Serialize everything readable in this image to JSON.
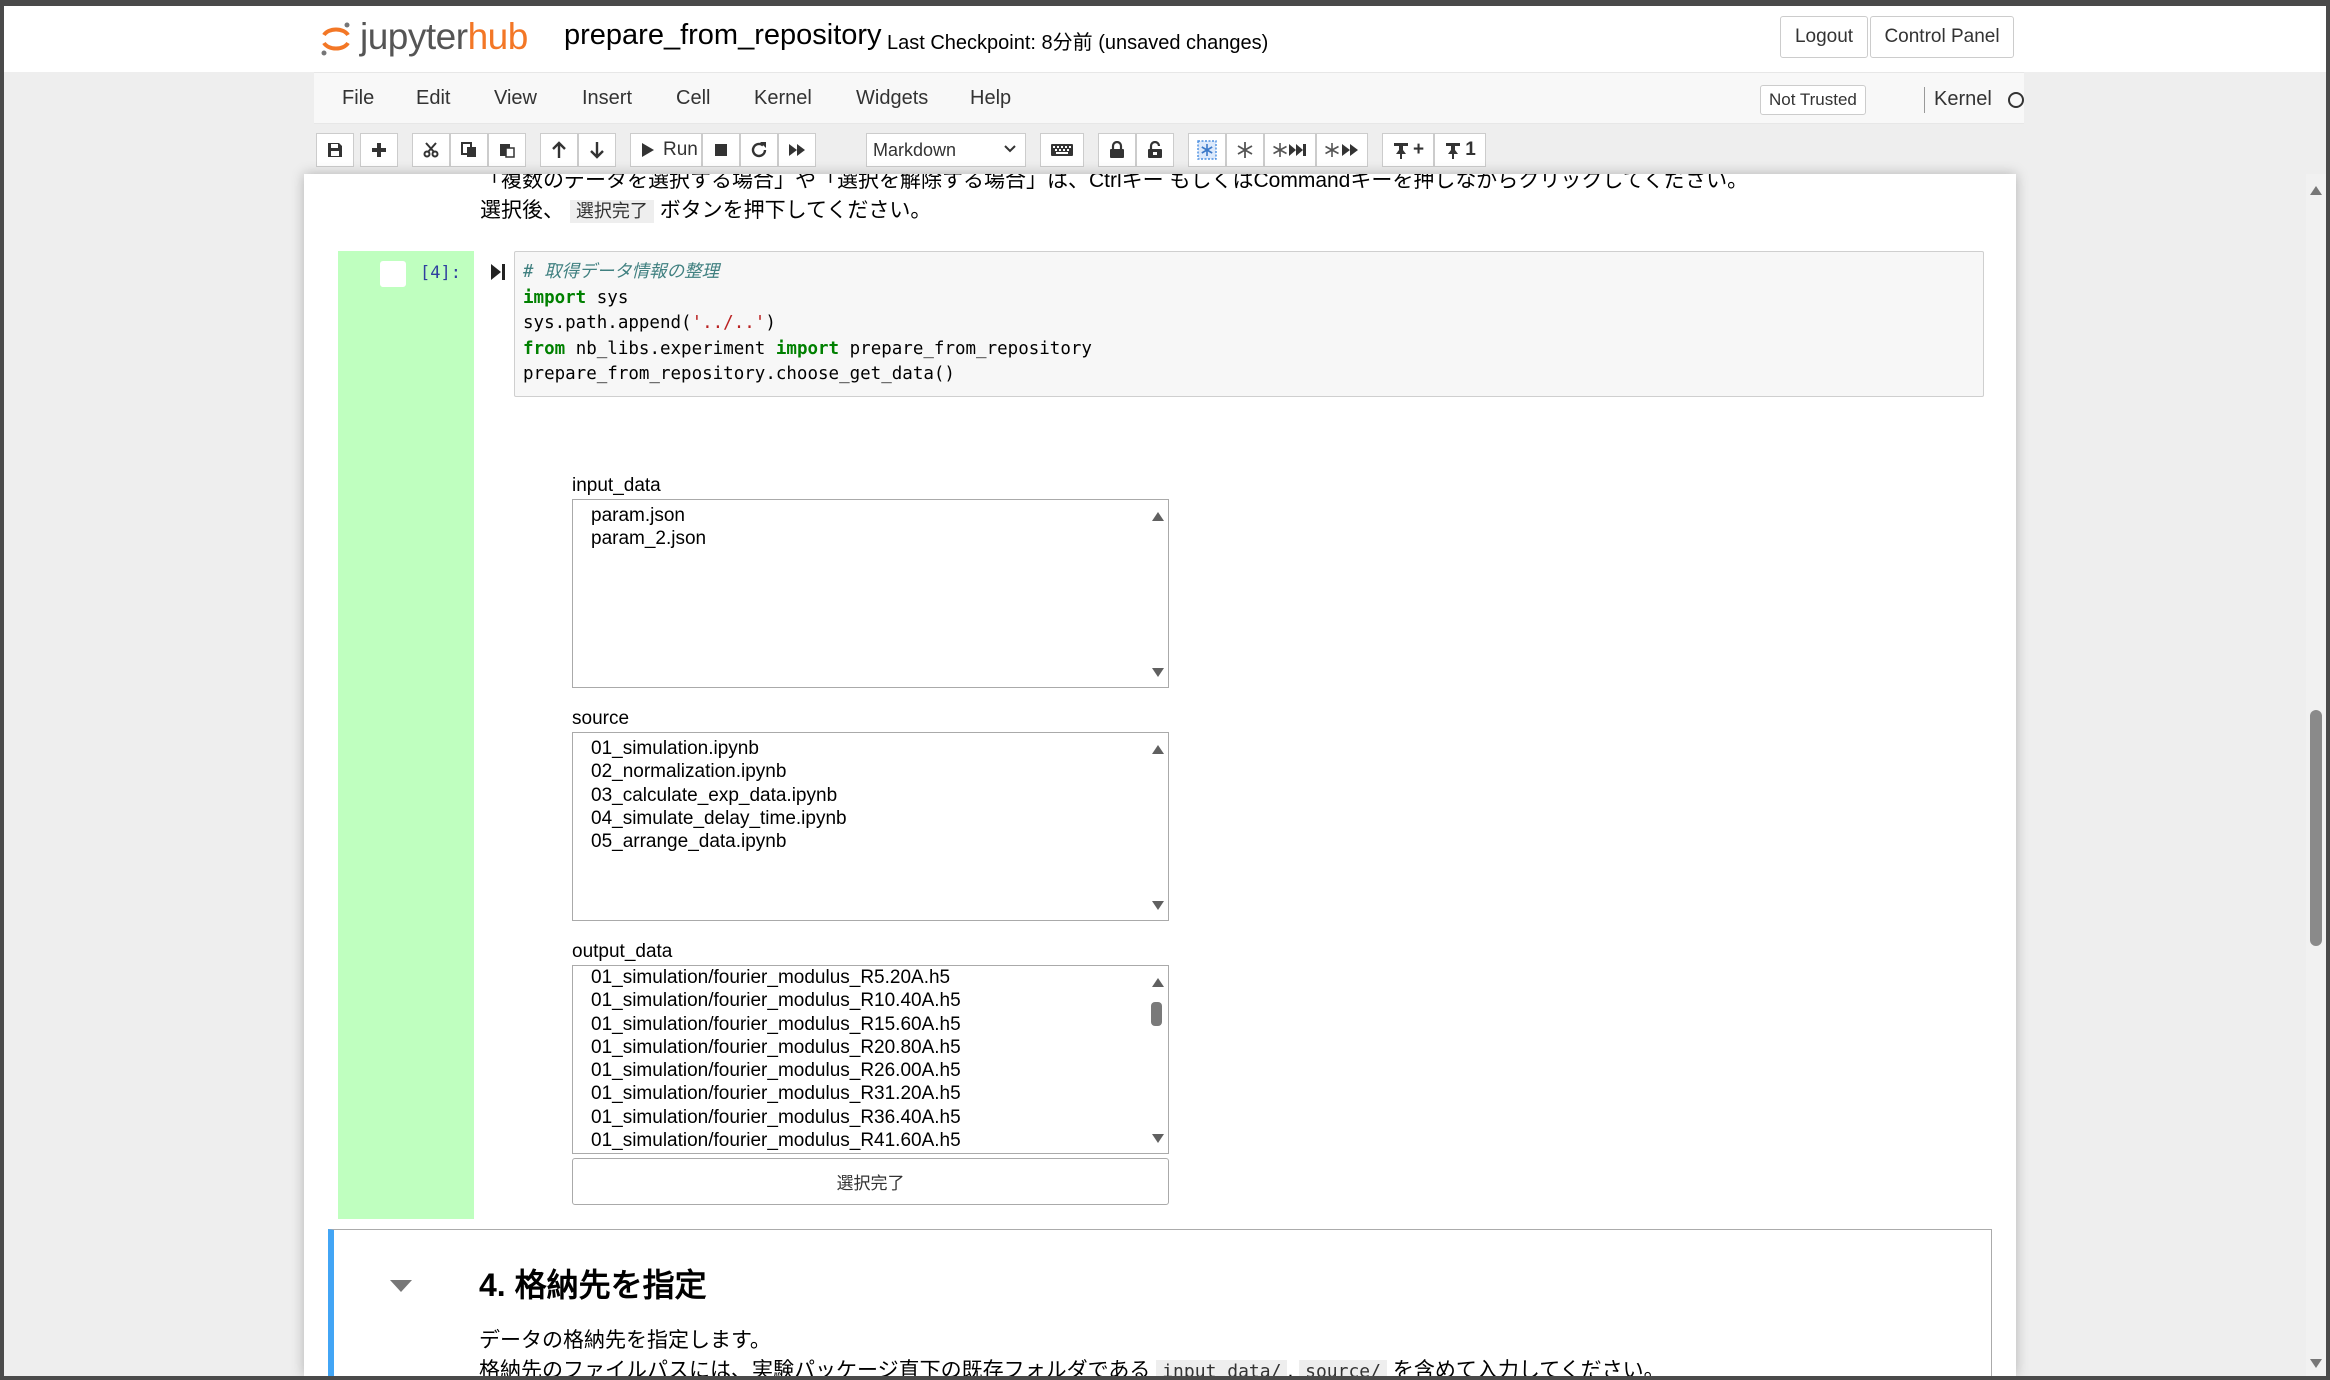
{
  "header": {
    "logo_jupyter": "jupyter",
    "logo_hub": "hub",
    "notebook_title": "prepare_from_repository",
    "checkpoint": "Last Checkpoint: 8分前   (unsaved changes)",
    "logout_label": "Logout",
    "control_panel_label": "Control Panel",
    "brand_color": "#f37726"
  },
  "menubar": {
    "items": [
      "File",
      "Edit",
      "View",
      "Insert",
      "Cell",
      "Kernel",
      "Widgets",
      "Help"
    ],
    "not_trusted": "Not Trusted",
    "kernel_label": "Kernel"
  },
  "toolbar": {
    "run_label": "Run",
    "cell_type": "Markdown",
    "icons": [
      "save-icon",
      "plus-icon",
      "cut-icon",
      "copy-icon",
      "paste-icon",
      "arrow-up-icon",
      "arrow-down-icon",
      "run-icon",
      "stop-icon",
      "restart-icon",
      "fast-forward-icon",
      "keyboard-icon",
      "lock-icon",
      "unlock-icon",
      "freeze-icon",
      "snowflake-icon",
      "snowflake-skip-icon",
      "snowflake-forward-icon",
      "pin-plus-icon",
      "pin-one-icon"
    ],
    "pin_plus_text": "+",
    "pin_one_text": "1"
  },
  "notebook": {
    "top_line1": "「複数のデータを選択する場合」や「選択を解除する場合」は、Ctrlキー もしくはCommandキーを押しながらクリックしてください。",
    "top_line2_pre": "選択後、",
    "top_line2_kbd": "選択完了",
    "top_line2_post": "ボタンを押下してください。",
    "cell4": {
      "prompt": "[4]:",
      "code_comment": "# 取得データ情報の整理",
      "code_kw_import": "import",
      "code_sys": " sys",
      "code_line3_a": "sys.path.append(",
      "code_line3_str": "'../..'",
      "code_line3_b": ")",
      "code_kw_from": "from",
      "code_line4_mod": " nb_libs.experiment ",
      "code_line4_name": " prepare_from_repository",
      "code_line5": "prepare_from_repository.choose_get_data()"
    },
    "widgets": {
      "input_data_label": "input_data",
      "input_data_items": [
        "param.json",
        "param_2.json"
      ],
      "source_label": "source",
      "source_items": [
        "01_simulation.ipynb",
        "02_normalization.ipynb",
        "03_calculate_exp_data.ipynb",
        "04_simulate_delay_time.ipynb",
        "05_arrange_data.ipynb"
      ],
      "output_data_label": "output_data",
      "output_data_items": [
        "01_simulation/fourier_modulus_R5.20A.h5",
        "01_simulation/fourier_modulus_R10.40A.h5",
        "01_simulation/fourier_modulus_R15.60A.h5",
        "01_simulation/fourier_modulus_R20.80A.h5",
        "01_simulation/fourier_modulus_R26.00A.h5",
        "01_simulation/fourier_modulus_R31.20A.h5",
        "01_simulation/fourier_modulus_R36.40A.h5",
        "01_simulation/fourier_modulus_R41.60A.h5"
      ],
      "done_button": "選択完了"
    },
    "md_cell": {
      "heading": "4. 格納先を指定",
      "p1": "データの格納先を指定します。",
      "p2_pre": "格納先のファイルパスには、実験パッケージ直下の既存フォルダである",
      "p2_code1": "input_data/",
      "p2_sep": ",",
      "p2_code2": "source/",
      "p2_post": "を含めて入力してください。"
    }
  }
}
